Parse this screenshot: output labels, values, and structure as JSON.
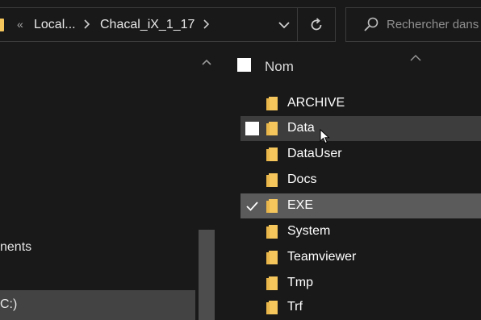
{
  "address_bar": {
    "overflow": "«",
    "crumbs": [
      "Local...",
      "Chacal_iX_1_17"
    ]
  },
  "search": {
    "placeholder": "Rechercher dans"
  },
  "nav_pane": {
    "items": [
      {
        "label": "nents"
      },
      {
        "label": "C:)"
      }
    ]
  },
  "file_list": {
    "column_header": "Nom",
    "items": [
      {
        "name": "ARCHIVE",
        "state": "normal"
      },
      {
        "name": "Data",
        "state": "hover"
      },
      {
        "name": "DataUser",
        "state": "normal"
      },
      {
        "name": "Docs",
        "state": "normal"
      },
      {
        "name": "EXE",
        "state": "selected",
        "checked": true
      },
      {
        "name": "System",
        "state": "normal"
      },
      {
        "name": "Teamviewer",
        "state": "normal"
      },
      {
        "name": "Tmp",
        "state": "normal"
      },
      {
        "name": "Trf",
        "state": "normal"
      }
    ]
  },
  "colors": {
    "background": "#191919",
    "folder": "#f5c65c",
    "row_hover": "#3d3d3d",
    "row_selected": "#5b5b5b"
  }
}
